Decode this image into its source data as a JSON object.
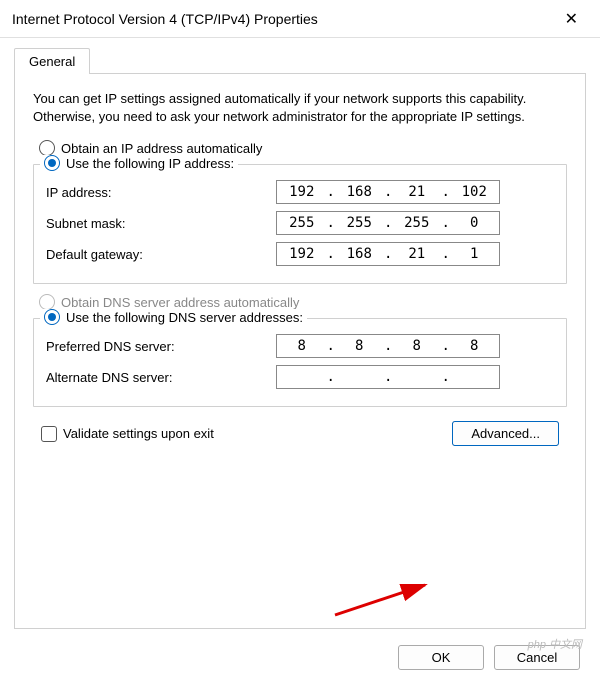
{
  "window": {
    "title": "Internet Protocol Version 4 (TCP/IPv4) Properties"
  },
  "tabs": {
    "general": "General"
  },
  "description": "You can get IP settings assigned automatically if your network supports this capability. Otherwise, you need to ask your network administrator for the appropriate IP settings.",
  "ip_section": {
    "auto_label": "Obtain an IP address automatically",
    "manual_label": "Use the following IP address:",
    "ip_label": "IP address:",
    "mask_label": "Subnet mask:",
    "gw_label": "Default gateway:",
    "ip": {
      "o1": "192",
      "o2": "168",
      "o3": "21",
      "o4": "102"
    },
    "mask": {
      "o1": "255",
      "o2": "255",
      "o3": "255",
      "o4": "0"
    },
    "gw": {
      "o1": "192",
      "o2": "168",
      "o3": "21",
      "o4": "1"
    }
  },
  "dns_section": {
    "auto_label": "Obtain DNS server address automatically",
    "manual_label": "Use the following DNS server addresses:",
    "pref_label": "Preferred DNS server:",
    "alt_label": "Alternate DNS server:",
    "pref": {
      "o1": "8",
      "o2": "8",
      "o3": "8",
      "o4": "8"
    },
    "alt": {
      "o1": "",
      "o2": "",
      "o3": "",
      "o4": ""
    }
  },
  "validate_label": "Validate settings upon exit",
  "buttons": {
    "advanced": "Advanced...",
    "ok": "OK",
    "cancel": "Cancel"
  },
  "watermark": "php 中文网"
}
